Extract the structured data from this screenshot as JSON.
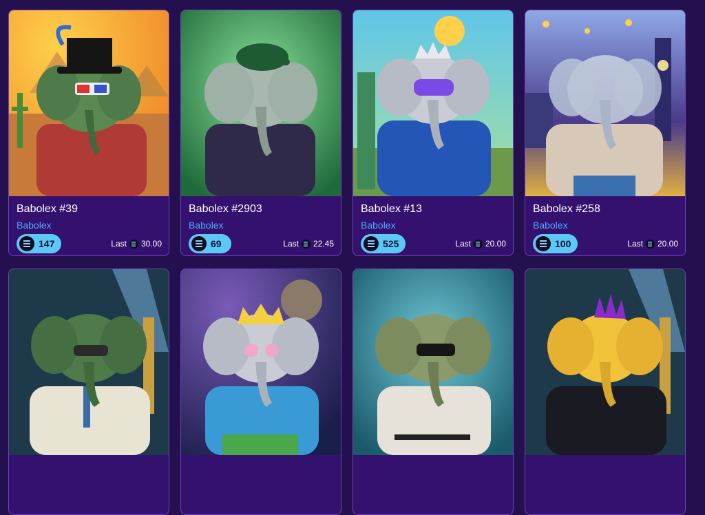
{
  "cards": [
    {
      "title": "Babolex #39",
      "collection": "Babolex",
      "price": "147",
      "last_label": "Last",
      "last_price": "30.00",
      "art_icon": "elephant-tophat-icon"
    },
    {
      "title": "Babolex #2903",
      "collection": "Babolex",
      "price": "69",
      "last_label": "Last",
      "last_price": "22.45",
      "art_icon": "elephant-cap-icon"
    },
    {
      "title": "Babolex #13",
      "collection": "Babolex",
      "price": "525",
      "last_label": "Last",
      "last_price": "20.00",
      "art_icon": "elephant-chrome-crown-icon"
    },
    {
      "title": "Babolex #258",
      "collection": "Babolex",
      "price": "100",
      "last_label": "Last",
      "last_price": "20.00",
      "art_icon": "elephant-ghost-icon"
    },
    {
      "art_icon": "elephant-green-suit-icon"
    },
    {
      "art_icon": "elephant-crown-heart-glasses-icon"
    },
    {
      "art_icon": "elephant-zombie-icon"
    },
    {
      "art_icon": "elephant-gold-punk-icon"
    }
  ],
  "colors": {
    "background": "#24104e",
    "card": "#34116e",
    "card_border": "#6b45b8",
    "pill": "#5bc8f5",
    "collection_link": "#4fa8ff"
  }
}
